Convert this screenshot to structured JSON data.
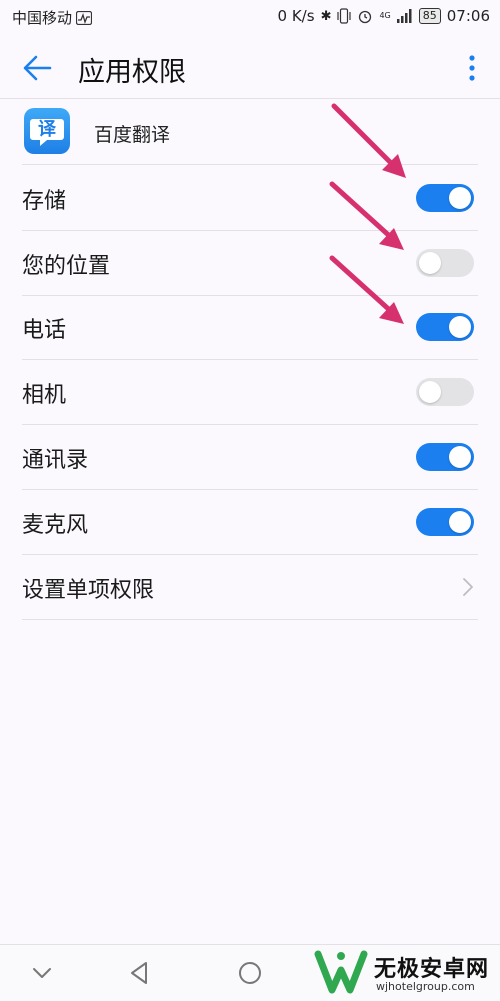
{
  "status_bar": {
    "carrier": "中国移动",
    "net_speed": "0 K/s",
    "network_type": "4G",
    "battery": "85",
    "time": "07:06"
  },
  "header": {
    "title": "应用权限"
  },
  "app": {
    "name": "百度翻译",
    "icon_glyph": "译"
  },
  "permissions": [
    {
      "label": "存储",
      "enabled": true
    },
    {
      "label": "您的位置",
      "enabled": false
    },
    {
      "label": "电话",
      "enabled": true
    },
    {
      "label": "相机",
      "enabled": false
    },
    {
      "label": "通讯录",
      "enabled": true
    },
    {
      "label": "麦克风",
      "enabled": true
    }
  ],
  "settings_item": {
    "label": "设置单项权限"
  },
  "watermark": {
    "title": "无极安卓网",
    "url": "wjhotelgroup.com"
  },
  "colors": {
    "accent": "#1b7ff0",
    "annotation_arrow": "#d6306f",
    "background": "#fbf9fe"
  }
}
